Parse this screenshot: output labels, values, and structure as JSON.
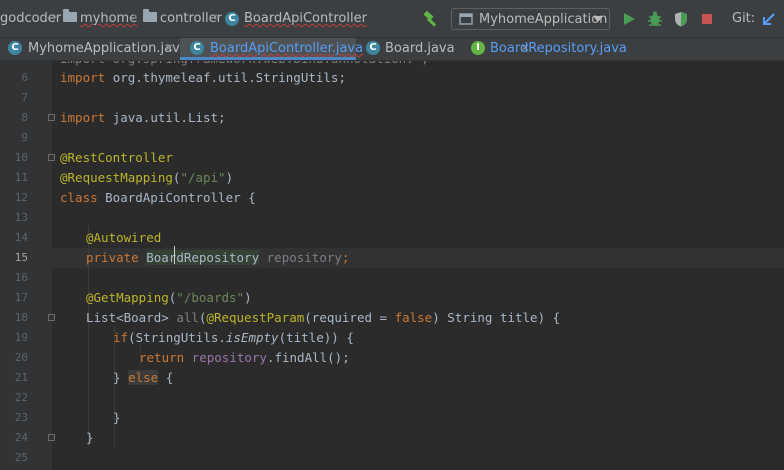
{
  "navbar": {
    "breadcrumbs": [
      "godcoder",
      "myhome",
      "controller",
      "BoardApiController"
    ],
    "run_config": "MyhomeApplication",
    "git_label": "Git:"
  },
  "tabs": [
    {
      "label": "MyhomeApplication.java",
      "icon": "class-icon",
      "active": false
    },
    {
      "label": "BoardApiController.java",
      "icon": "class-icon",
      "active": true
    },
    {
      "label": "Board.java",
      "icon": "class-icon",
      "active": false
    },
    {
      "label": "BoardRepository.java",
      "icon": "interface-icon",
      "active": false
    }
  ],
  "editor": {
    "current_line": 15,
    "line_numbers": [
      "6",
      "7",
      "8",
      "9",
      "10",
      "11",
      "12",
      "13",
      "14",
      "15",
      "16",
      "17",
      "18",
      "19",
      "20",
      "21",
      "22",
      "23",
      "24",
      "25"
    ],
    "partial_top": "import org.springframework.web.bind.annotation.*;",
    "lines": {
      "l6_kw": "import ",
      "l6_rest": "org.thymeleaf.util.StringUtils;",
      "l8_kw": "import ",
      "l8_rest": "java.util.List;",
      "l10_ann": "@RestController",
      "l11_ann": "@RequestMapping",
      "l11_p1": "(",
      "l11_str": "\"/api\"",
      "l11_p2": ")",
      "l12_kw": "class ",
      "l12_rest": "BoardApiController {",
      "l14_ann": "@Autowired",
      "l15_kw": "private ",
      "l15_type": "BoardRepository",
      "l15_sp": " ",
      "l15_fld": "repository",
      "l15_end": ";",
      "l17_ann": "@GetMapping",
      "l17_p1": "(",
      "l17_str": "\"/boards\"",
      "l17_p2": ")",
      "l18_a": "List<Board> ",
      "l18_b": "all",
      "l18_c": "(",
      "l18_ann": "@RequestParam",
      "l18_d": "(required = ",
      "l18_kw": "false",
      "l18_e": ") String title) {",
      "l19_kw": "if",
      "l19_a": "(StringUtils.",
      "l19_m": "isEmpty",
      "l19_b": "(title)) {",
      "l20_kw": "return ",
      "l20_fld": "repository",
      "l20_rest": ".findAll();",
      "l21_a": "} ",
      "l21_kw": "else",
      "l21_b": " {",
      "l23": "}",
      "l24": "}"
    }
  },
  "colors": {
    "keyword": "#cc7832",
    "annotation": "#bbb529",
    "string": "#6a8759",
    "field": "#9876aa",
    "accent": "#4a88c7"
  }
}
